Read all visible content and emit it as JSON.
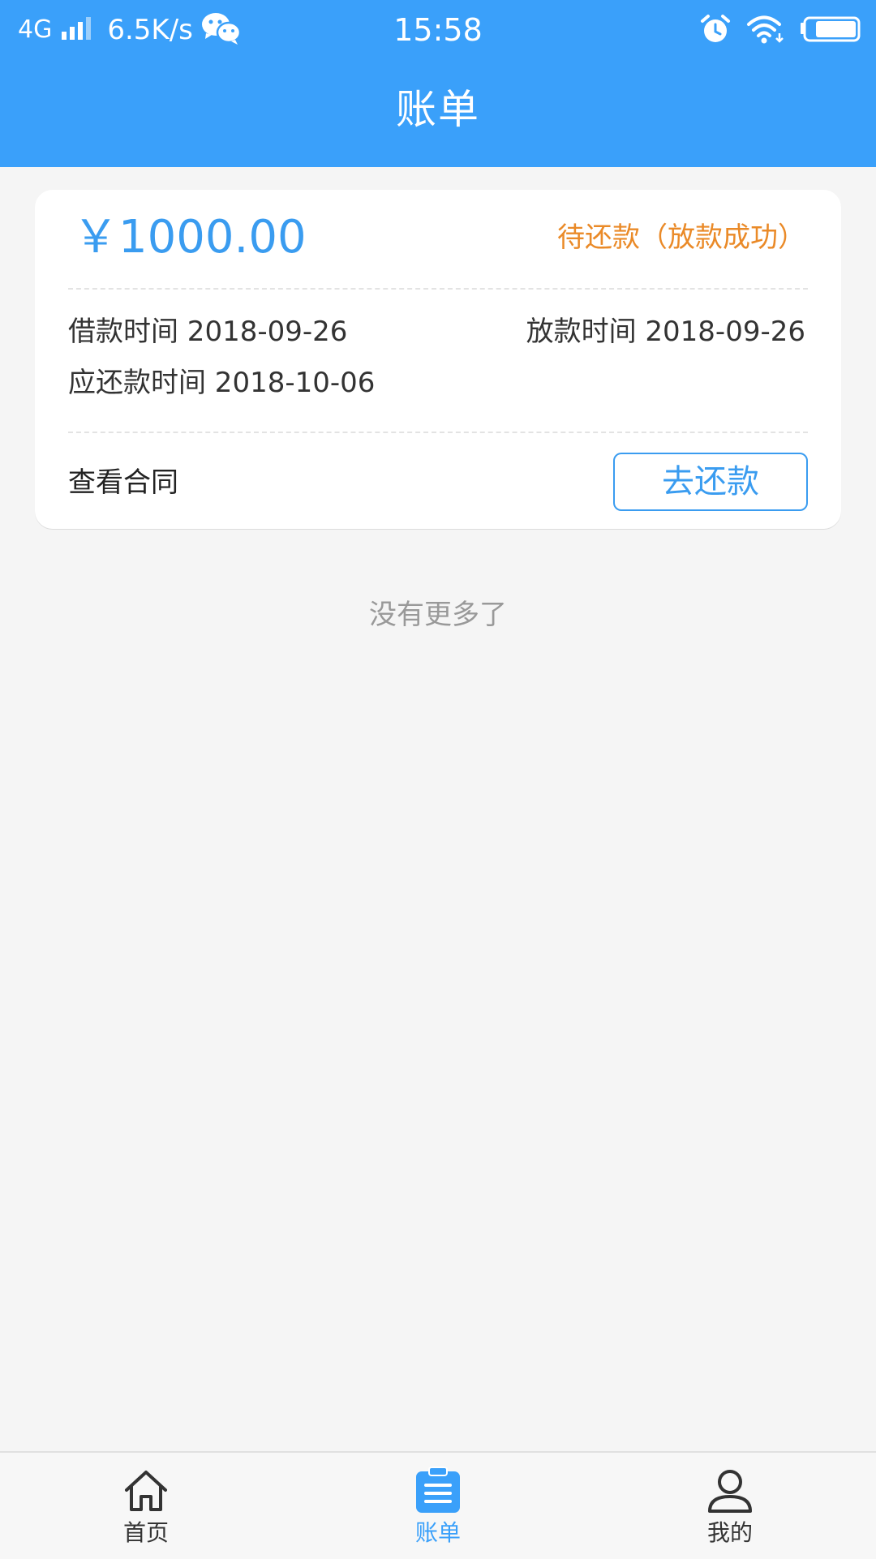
{
  "status_bar": {
    "network": "4G",
    "speed": "6.5K/s",
    "time": "15:58"
  },
  "header": {
    "title": "账单"
  },
  "bill": {
    "amount": "￥1000.00",
    "status": "待还款（放款成功）",
    "borrow_time": "借款时间 2018-09-26",
    "release_time": "放款时间 2018-09-26",
    "due_time": "应还款时间 2018-10-06",
    "contract_label": "查看合同",
    "repay_label": "去还款"
  },
  "list_end": "没有更多了",
  "tabs": [
    {
      "label": "首页"
    },
    {
      "label": "账单"
    },
    {
      "label": "我的"
    }
  ],
  "colors": {
    "primary": "#3aa0fa",
    "status": "#ea8a28"
  }
}
